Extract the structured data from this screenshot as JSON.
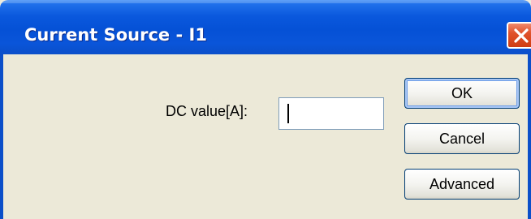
{
  "window": {
    "title": "Current Source - I1",
    "close_icon": "close-icon"
  },
  "form": {
    "dc_value_label": "DC value[A]:",
    "dc_value": ""
  },
  "buttons": {
    "ok_label": "OK",
    "cancel_label": "Cancel",
    "advanced_label": "Advanced"
  },
  "colors": {
    "titlebar": "#0551d6",
    "body": "#ece9d8",
    "close": "#e0522c"
  }
}
